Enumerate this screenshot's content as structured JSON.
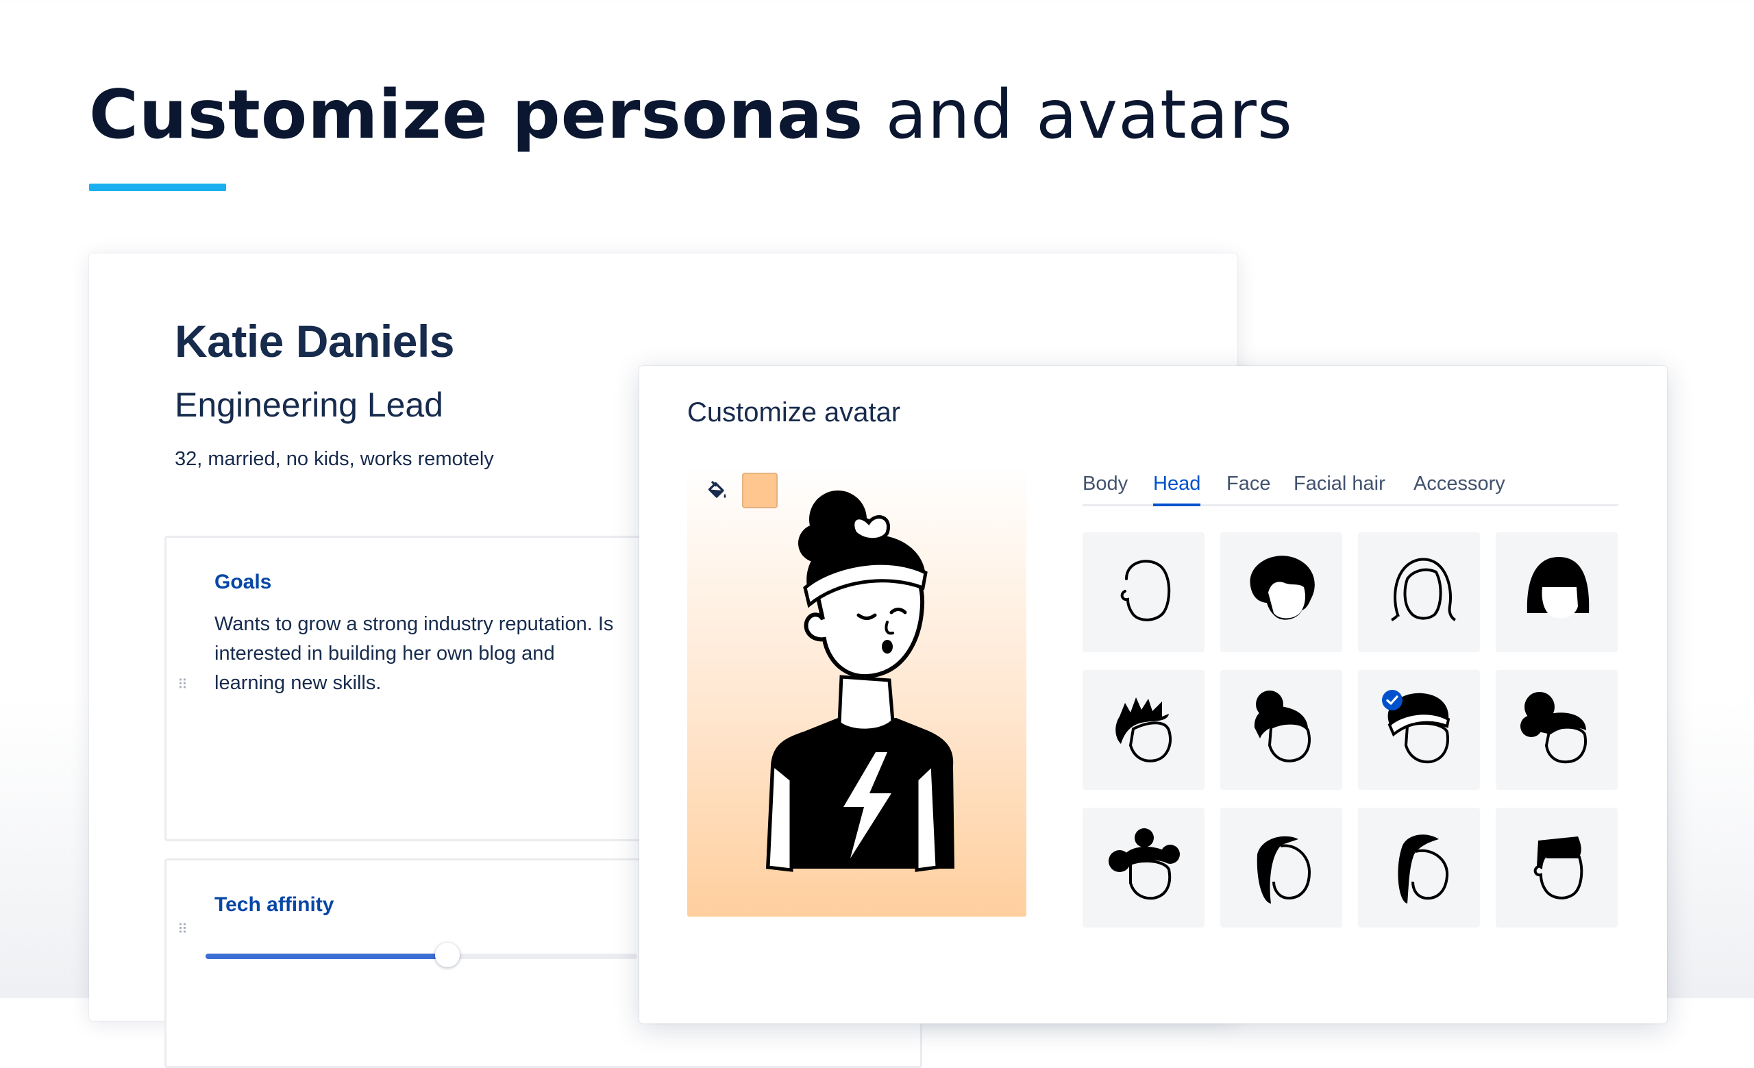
{
  "hero": {
    "title_bold": "Customize personas",
    "title_light": "and avatars"
  },
  "persona": {
    "name": "Katie Daniels",
    "role": "Engineering Lead",
    "description": "32, married, no kids, works remotely",
    "goals": {
      "title": "Goals",
      "text": "Wants to grow a strong industry reputation. Is interested in building her own blog and learning new skills."
    },
    "tech_affinity": {
      "title": "Tech affinity",
      "level_fraction": 0.56
    }
  },
  "avatar_modal": {
    "title": "Customize avatar",
    "skin_color": "#ffc68f",
    "tabs": [
      "Body",
      "Head",
      "Face",
      "Facial hair",
      "Accessory"
    ],
    "active_tab": "Head",
    "head_options": [
      {
        "icon": "bald-head-icon",
        "selected": false
      },
      {
        "icon": "afro-head-icon",
        "selected": false
      },
      {
        "icon": "long-hair-head-icon",
        "selected": false
      },
      {
        "icon": "bob-bangs-head-icon",
        "selected": false
      },
      {
        "icon": "spiky-hair-head-icon",
        "selected": false
      },
      {
        "icon": "top-bun-head-icon",
        "selected": false
      },
      {
        "icon": "bandana-curly-head-icon",
        "selected": true
      },
      {
        "icon": "curly-updo-head-icon",
        "selected": false
      },
      {
        "icon": "space-buns-head-icon",
        "selected": false
      },
      {
        "icon": "ponytail-head-icon",
        "selected": false
      },
      {
        "icon": "braid-head-icon",
        "selected": false
      },
      {
        "icon": "short-crop-head-icon",
        "selected": false
      }
    ]
  },
  "colors": {
    "accent_underline": "#1ab0f0",
    "link_blue": "#0747a6",
    "tab_active": "#0052cc",
    "slider_fill": "#3b6fd4"
  }
}
